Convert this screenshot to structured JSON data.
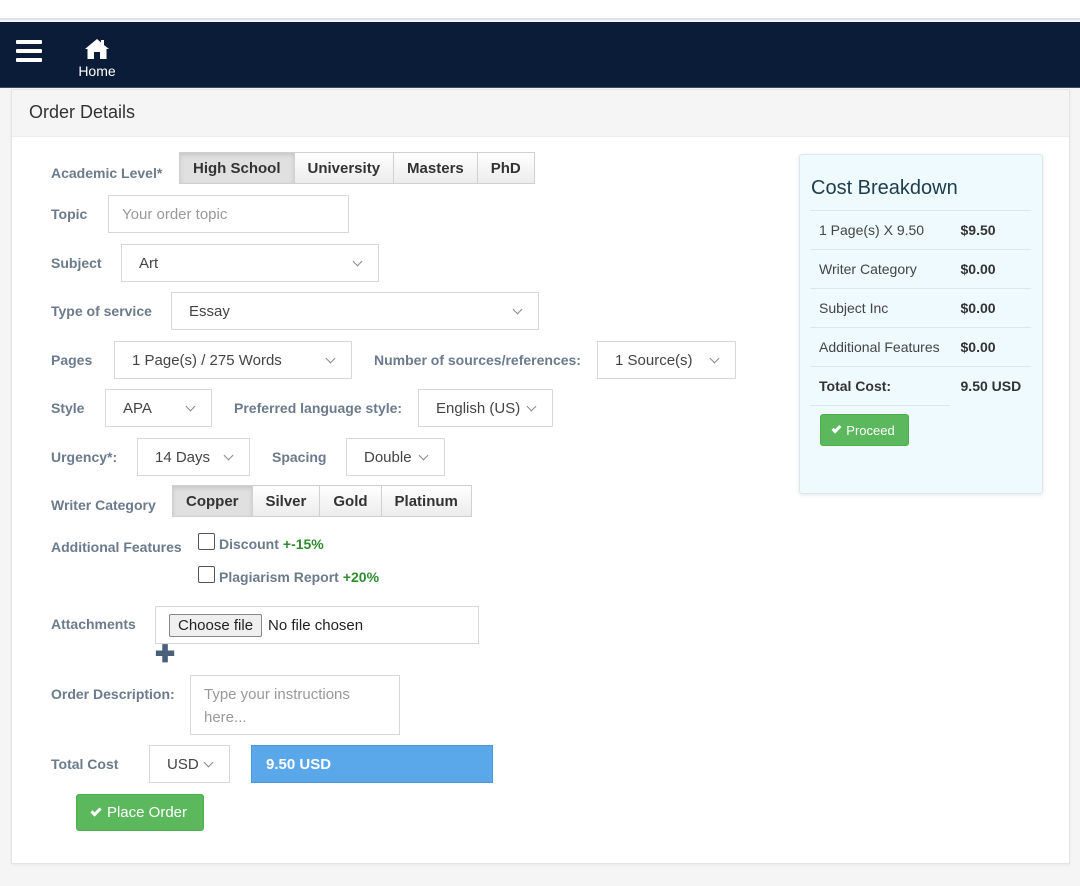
{
  "nav": {
    "menu_icon": "hamburger-menu-icon",
    "home_icon": "home-icon",
    "home_label": "Home"
  },
  "panel": {
    "title": "Order Details"
  },
  "form": {
    "academic_level": {
      "label": "Academic Level*",
      "options": [
        "High School",
        "University",
        "Masters",
        "PhD"
      ],
      "selected": "High School"
    },
    "topic": {
      "label": "Topic",
      "placeholder": "Your order topic",
      "value": ""
    },
    "subject": {
      "label": "Subject",
      "value": "Art"
    },
    "type_of_service": {
      "label": "Type of service",
      "value": "Essay"
    },
    "pages": {
      "label": "Pages",
      "value": "1 Page(s) / 275 Words"
    },
    "sources": {
      "label": "Number of sources/references:",
      "value": "1 Source(s)"
    },
    "style": {
      "label": "Style",
      "value": "APA"
    },
    "language": {
      "label": "Preferred language style:",
      "value": "English (US)"
    },
    "urgency": {
      "label": "Urgency*:",
      "value": "14 Days"
    },
    "spacing": {
      "label": "Spacing",
      "value": "Double"
    },
    "writer_category": {
      "label": "Writer Category",
      "options": [
        "Copper",
        "Silver",
        "Gold",
        "Platinum"
      ],
      "selected": "Copper"
    },
    "additional_features": {
      "label": "Additional Features",
      "items": [
        {
          "name": "Discount",
          "modifier": "+-15%",
          "checked": false
        },
        {
          "name": "Plagiarism Report",
          "modifier": "+20%",
          "checked": false
        }
      ]
    },
    "attachments": {
      "label": "Attachments",
      "button_label": "Choose file",
      "status": "No file chosen",
      "add_icon": "plus-icon"
    },
    "description": {
      "label": "Order Description:",
      "placeholder": "Type your instructions here...",
      "value": ""
    },
    "total": {
      "label": "Total Cost",
      "currency": "USD",
      "value": "9.50 USD"
    },
    "place_order_label": "Place Order"
  },
  "cost_breakdown": {
    "title": "Cost Breakdown",
    "rows": [
      {
        "label": "1 Page(s) X 9.50",
        "amount": "$9.50"
      },
      {
        "label": "Writer Category",
        "amount": "$0.00"
      },
      {
        "label": "Subject Inc",
        "amount": "$0.00"
      },
      {
        "label": "Additional Features",
        "amount": "$0.00"
      }
    ],
    "total_label": "Total Cost:",
    "total_amount": "9.50 USD",
    "proceed_label": "Proceed"
  },
  "colors": {
    "navbar": "#0a1c38",
    "success": "#5cb85c",
    "total_field": "#5aa7ea",
    "modifier_green": "#2e8b2e",
    "label_gray": "#6b7b8c"
  }
}
